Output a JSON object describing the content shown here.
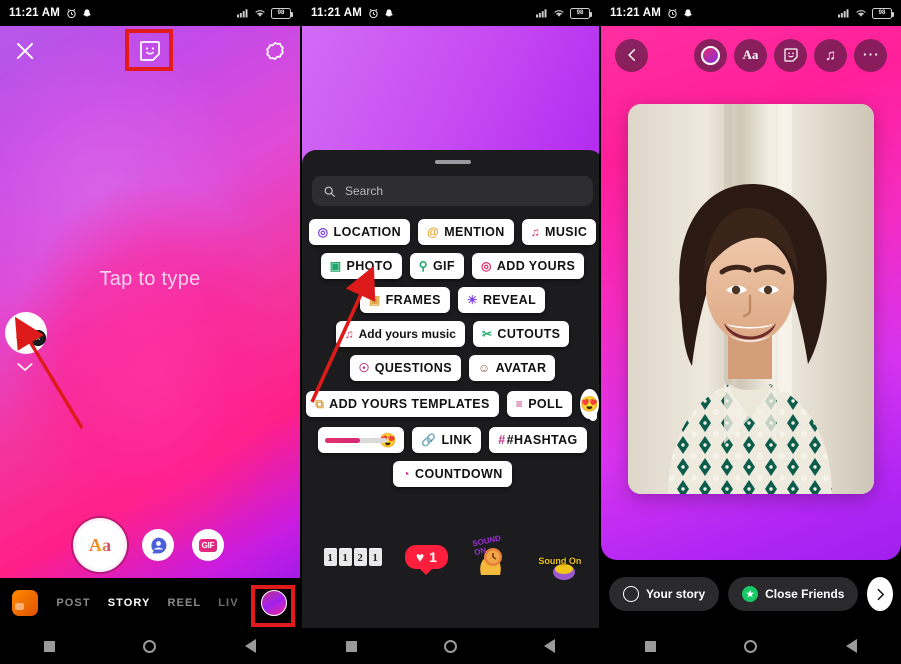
{
  "status_bar": {
    "time": "11:21 AM",
    "alarm_icon": "alarm-icon",
    "notification_icon": "snapchat-notification-icon",
    "signal_icon": "cellular-signal-icon",
    "wifi_icon": "wifi-icon",
    "battery_level": "98"
  },
  "panel1": {
    "name": "instagram-story-text-composer",
    "close_label": "×",
    "sticker_icon": "sticker-smiley-icon",
    "settings_icon": "settings-gear-icon",
    "canvas_placeholder": "Tap to type",
    "font_chip_label": "Aa",
    "font_chip_close": "×",
    "chevron_icon": "chevron-down-icon",
    "tools": {
      "text_tool_label": "Aa",
      "avatar_tool_icon": "person-bubble-icon",
      "gif_tool_label": "GIF"
    },
    "bottom_bar": {
      "gallery_thumb": "gallery-thumbnail",
      "modes": [
        {
          "label": "POST",
          "active": false
        },
        {
          "label": "STORY",
          "active": true
        },
        {
          "label": "REEL",
          "active": false
        },
        {
          "label": "LIV",
          "active": false
        }
      ],
      "avatar": "profile-avatar"
    },
    "highlights": [
      "sticker-button-highlight",
      "profile-avatar-highlight"
    ]
  },
  "panel2": {
    "name": "instagram-sticker-tray",
    "search": {
      "placeholder": "Search",
      "icon": "search-icon"
    },
    "sticker_rows": [
      [
        {
          "label": "LOCATION",
          "icon": "location-pin-icon",
          "glyph": "◎",
          "color": "#7b3fe4",
          "style": "caps"
        },
        {
          "label": "MENTION",
          "icon": "at-mention-icon",
          "glyph": "@",
          "color": "#e8a020",
          "style": "caps"
        },
        {
          "label": "MUSIC",
          "icon": "music-note-icon",
          "glyph": "♫",
          "color": "#e1306c",
          "style": "caps"
        }
      ],
      [
        {
          "label": "PHOTO",
          "icon": "photo-image-icon",
          "glyph": "▣",
          "color": "#1fa86b",
          "style": "caps"
        },
        {
          "label": "GIF",
          "icon": "gif-search-icon",
          "glyph": "○",
          "color": "#1fa86b",
          "style": "caps"
        },
        {
          "label": "ADD YOURS",
          "icon": "camera-icon",
          "glyph": "◎",
          "color": "#e1306c",
          "style": "caps"
        }
      ],
      [
        {
          "label": "FRAMES",
          "icon": "frames-square-icon",
          "glyph": "▣",
          "color": "#d9a441",
          "style": "caps"
        },
        {
          "label": "REVEAL",
          "icon": "reveal-eye-icon",
          "glyph": "◠",
          "color": "#7b3fe4",
          "style": "caps"
        }
      ],
      [
        {
          "label": "Add yours music",
          "icon": "music-plus-icon",
          "glyph": "♫",
          "color": "#e1306c",
          "style": "mixed"
        },
        {
          "label": "CUTOUTS",
          "icon": "scissors-icon",
          "glyph": "✂",
          "color": "#1fa86b",
          "style": "caps"
        }
      ],
      [
        {
          "label": "QUESTIONS",
          "icon": "question-bubble-icon",
          "glyph": "?",
          "color": "#c13584",
          "style": "caps"
        },
        {
          "label": "AVATAR",
          "icon": "avatar-face-icon",
          "glyph": "☺",
          "color": "#8a5a3c",
          "style": "caps"
        }
      ],
      [
        {
          "label": "ADD YOURS TEMPLATES",
          "icon": "templates-stack-icon",
          "glyph": "⧉",
          "color": "#d9a441",
          "style": "caps"
        },
        {
          "label": "POLL",
          "icon": "poll-bars-icon",
          "glyph": "≡",
          "color": "#c13584",
          "style": "caps"
        },
        {
          "label": "",
          "icon": "emoji-reaction-bubble-icon",
          "glyph": "😍",
          "color": "#000000",
          "style": "emoji"
        }
      ],
      [
        {
          "label": "",
          "icon": "emoji-slider-icon",
          "glyph": "😍",
          "color": "#e1306c",
          "style": "slider"
        },
        {
          "label": "LINK",
          "icon": "link-chain-icon",
          "glyph": "🔗",
          "color": "#3ab0d8",
          "style": "caps"
        },
        {
          "label": "#HASHTAG",
          "icon": "hashtag-icon",
          "glyph": "",
          "color": "#c13584",
          "style": "caps"
        }
      ],
      [
        {
          "label": "COUNTDOWN",
          "icon": "countdown-clock-icon",
          "glyph": "◔",
          "color": "#c13584",
          "style": "caps"
        }
      ]
    ],
    "featured_stickers": [
      {
        "name": "flip-counter-sticker",
        "digits": [
          "1",
          "1",
          "2",
          "1"
        ]
      },
      {
        "name": "like-count-sticker",
        "heart": "♥",
        "count": "1"
      },
      {
        "name": "sound-on-hand-sticker",
        "text": "SOUND ON"
      },
      {
        "name": "sound-on-swirl-sticker",
        "text": "Sound On"
      }
    ]
  },
  "panel3": {
    "name": "instagram-story-photo-preview",
    "back_icon": "chevron-left-icon",
    "toolbar": [
      {
        "name": "color-picker-button",
        "icon": "gradient-circle-icon",
        "label": ""
      },
      {
        "name": "text-button",
        "icon": "text-aa-icon",
        "label": "Aa"
      },
      {
        "name": "sticker-button",
        "icon": "sticker-smiley-icon",
        "label": ""
      },
      {
        "name": "music-button",
        "icon": "music-note-icon",
        "label": "♫"
      },
      {
        "name": "more-button",
        "icon": "more-dots-icon",
        "label": "⋯"
      }
    ],
    "photo": {
      "name": "story-photo-card",
      "alt": "smiling-woman-portrait"
    },
    "share_bar": {
      "your_story_label": "Your story",
      "your_story_icon": "circle-outline-icon",
      "close_friends_label": "Close Friends",
      "close_friends_icon": "green-star-icon",
      "next_icon": "chevron-right-icon"
    }
  },
  "annotations": {
    "arrow1": "red-arrow-pointing-to-font-chip",
    "arrow2": "red-arrow-pointing-to-photo-sticker",
    "arrow_color": "#dd1a1a",
    "highlight_color": "#e11b1b"
  },
  "nav_bar": {
    "recents_icon": "square-recents-icon",
    "home_icon": "circle-home-icon",
    "back_icon": "triangle-back-icon"
  }
}
